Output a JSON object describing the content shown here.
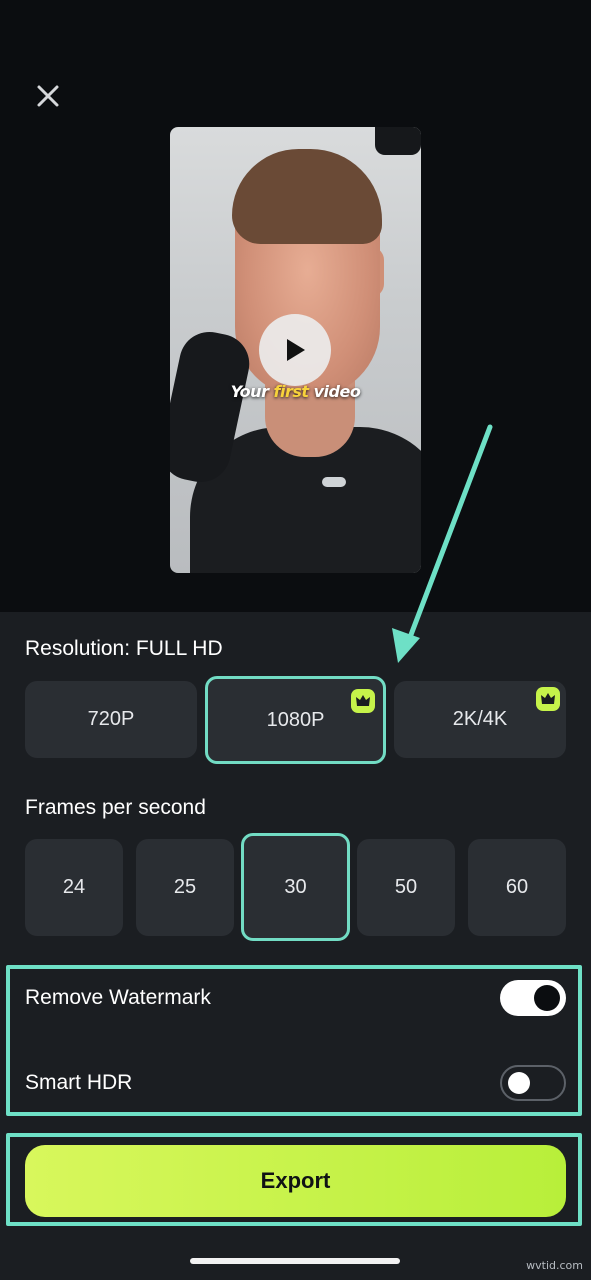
{
  "header": {
    "close_icon": "close-icon"
  },
  "preview": {
    "caption_part1": "Your ",
    "caption_highlight": "first",
    "caption_part2": " video",
    "play_icon": "play-icon"
  },
  "resolution": {
    "label": "Resolution: FULL HD",
    "options": [
      {
        "label": "720P",
        "premium": false,
        "selected": false
      },
      {
        "label": "1080P",
        "premium": true,
        "selected": true
      },
      {
        "label": "2K/4K",
        "premium": true,
        "selected": false
      }
    ],
    "premium_icon": "crown-icon"
  },
  "fps": {
    "label": "Frames per second",
    "options": [
      {
        "label": "24",
        "selected": false
      },
      {
        "label": "25",
        "selected": false
      },
      {
        "label": "30",
        "selected": true
      },
      {
        "label": "50",
        "selected": false
      },
      {
        "label": "60",
        "selected": false
      }
    ]
  },
  "settings": {
    "remove_watermark": {
      "label": "Remove Watermark",
      "enabled": true
    },
    "smart_hdr": {
      "label": "Smart HDR",
      "enabled": false
    }
  },
  "export": {
    "label": "Export"
  },
  "footer": {
    "watermark": "wvtid.com"
  },
  "colors": {
    "accent_lime": "#c6f34a",
    "annotation_teal": "#6ee0c6",
    "caption_highlight": "#f7d23b"
  }
}
